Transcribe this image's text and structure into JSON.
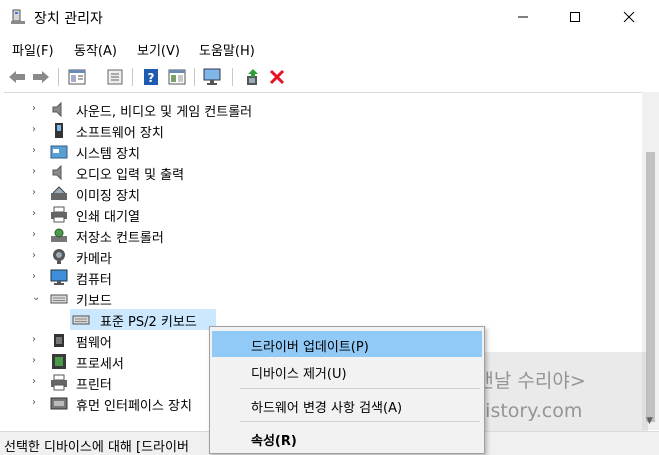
{
  "window": {
    "title": "장치 관리자"
  },
  "menubar": [
    "파일(F)",
    "동작(A)",
    "보기(V)",
    "도움말(H)"
  ],
  "toolbar_icons": [
    "back-arrow-icon",
    "forward-arrow-icon",
    "properties-icon",
    "show-hidden-icon",
    "help-icon",
    "view-icon",
    "monitor-scan-icon",
    "update-driver-icon",
    "uninstall-x-icon"
  ],
  "tree": {
    "items": [
      {
        "label": "사운드, 비디오 및 게임 컨트롤러",
        "icon": "speaker-icon",
        "expanded": false
      },
      {
        "label": "소프트웨어 장치",
        "icon": "software-device-icon",
        "expanded": false
      },
      {
        "label": "시스템 장치",
        "icon": "system-folder-icon",
        "expanded": false
      },
      {
        "label": "오디오 입력 및 출력",
        "icon": "speaker-icon",
        "expanded": false
      },
      {
        "label": "이미징 장치",
        "icon": "camera-imaging-icon",
        "expanded": false
      },
      {
        "label": "인쇄 대기열",
        "icon": "printer-icon",
        "expanded": false
      },
      {
        "label": "저장소 컨트롤러",
        "icon": "storage-controller-icon",
        "expanded": false
      },
      {
        "label": "카메라",
        "icon": "webcam-icon",
        "expanded": false
      },
      {
        "label": "컴퓨터",
        "icon": "monitor-icon",
        "expanded": false
      },
      {
        "label": "키보드",
        "icon": "keyboard-icon",
        "expanded": true
      },
      {
        "label": "펌웨어",
        "icon": "chip-icon",
        "expanded": false
      },
      {
        "label": "프로세서",
        "icon": "processor-icon",
        "expanded": false
      },
      {
        "label": "프린터",
        "icon": "printer-icon",
        "expanded": false
      },
      {
        "label": "휴먼 인터페이스 장치",
        "icon": "hid-icon",
        "expanded": false
      }
    ],
    "child": {
      "label": "표준 PS/2 키보드",
      "icon": "keyboard-icon",
      "selected": true
    }
  },
  "context_menu": {
    "items": [
      "드라이버 업데이트(P)",
      "디바이스 제거(U)",
      "하드웨어 변경 사항 검색(A)",
      "속성(R)"
    ],
    "highlighted": 0
  },
  "watermark": {
    "line1": "유튜브 <맨날 수리야>",
    "line2": "m.sooriya.tistory.com"
  },
  "statusbar": {
    "text": "선택한 디바이스에 대해 [드라이버"
  },
  "colors": {
    "selection": "#cce8ff",
    "menu_highlight": "#91c9f7",
    "delete_red": "#e81123",
    "help_blue": "#1e5ab0"
  }
}
